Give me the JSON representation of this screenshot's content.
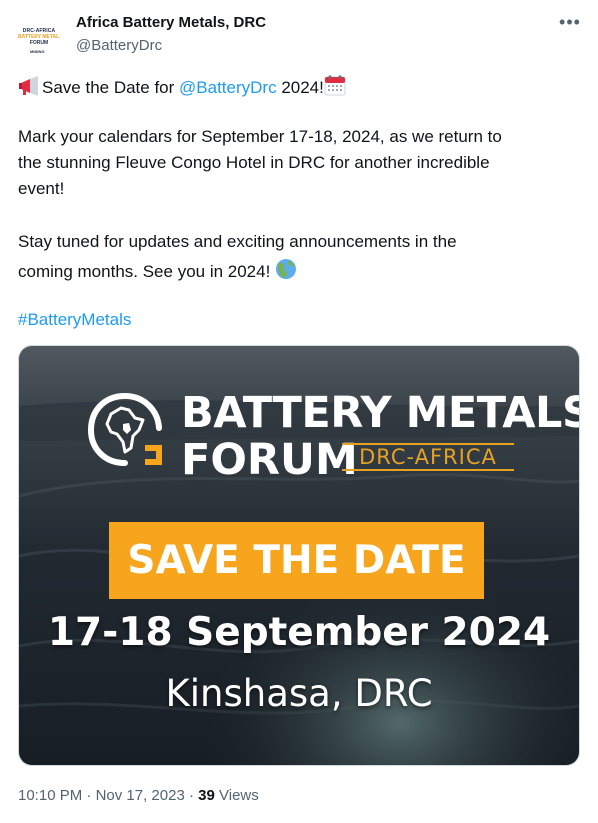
{
  "author": {
    "display_name": "Africa Battery Metals, DRC",
    "handle": "@BatteryDrc",
    "avatar_text": [
      "DRC-AFRICA",
      "BATTERY METALS",
      "FORUM",
      "MINING"
    ]
  },
  "menu": {
    "more_label": "•••"
  },
  "tweet": {
    "line1_prefix": "Save the Date for ",
    "line1_mention": "@BatteryDrc",
    "line1_suffix": " 2024!",
    "para2": [
      "Mark your calendars for September 17-18, 2024, as we return to",
      "the stunning Fleuve Congo Hotel in DRC for another incredible",
      "event!"
    ],
    "para3": [
      "Stay tuned for updates and exciting announcements in the",
      "coming months. See you in 2024!"
    ],
    "hashtag": "#BatteryMetals"
  },
  "card": {
    "brand_line1": "BATTERY METALS",
    "brand_line2": "FORUM",
    "brand_sub": "DRC-AFRICA",
    "cta": "SAVE THE DATE",
    "date": "17-18 September 2024",
    "location": "Kinshasa, DRC"
  },
  "meta": {
    "time": "10:10 PM",
    "date": "Nov 17, 2023",
    "views_count": "39",
    "views_label": "Views"
  },
  "colors": {
    "link": "#1d9bf0",
    "accent": "#f7a51c",
    "text": "#0f1419",
    "muted": "#536471"
  }
}
